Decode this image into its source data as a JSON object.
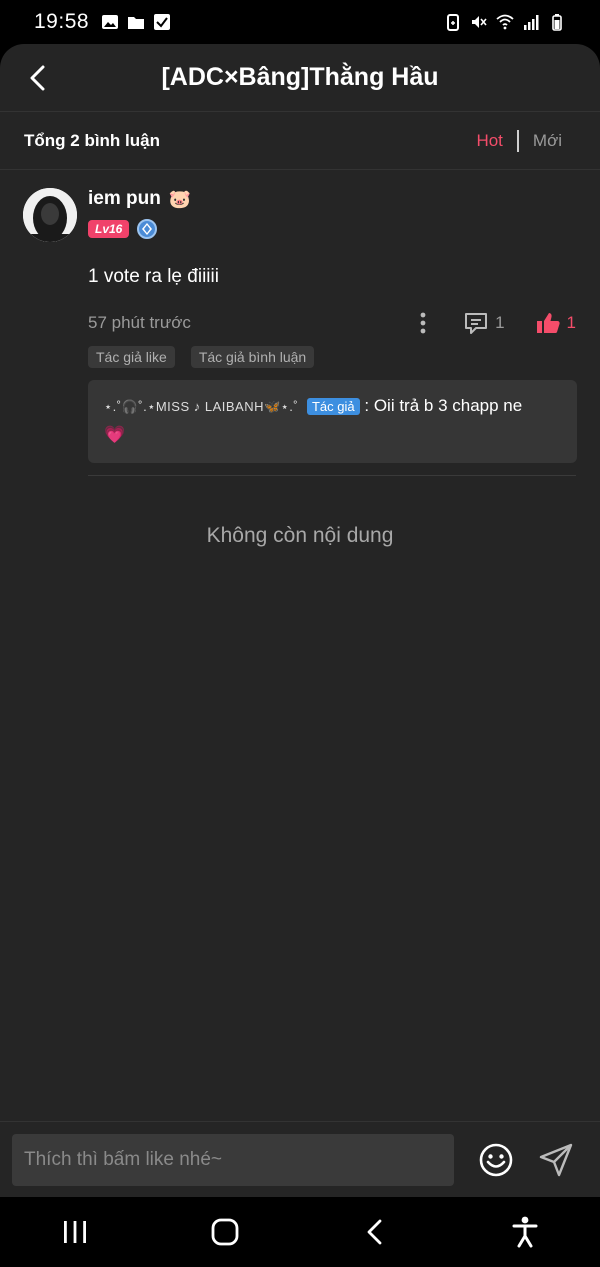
{
  "status_bar": {
    "time": "19:58",
    "left_icons": [
      "image-icon",
      "folder-icon",
      "checkbox-icon"
    ],
    "right_icons": [
      "battery-saver-icon",
      "mute-icon",
      "wifi-icon",
      "signal-icon",
      "battery-icon"
    ]
  },
  "header": {
    "title": "[ADC×Bâng]Thằng Hầu",
    "back_icon": "chevron-left-icon"
  },
  "comments_header": {
    "total_label": "Tổng 2 bình luận",
    "sort_hot": "Hot",
    "sort_new": "Mới",
    "active_sort": "Hot"
  },
  "comment": {
    "username": "iem pun",
    "username_emoji": "🐷",
    "level": "Lv16",
    "text": "1 vote ra lẹ điiiii",
    "timestamp": "57 phút trước",
    "reply_count": "1",
    "like_count": "1",
    "tags": [
      "Tác giả like",
      "Tác giả bình luận"
    ],
    "reply": {
      "author": "⋆.˚🎧˚.⋆MISS ♪ LAIBANH🦋⋆.˚",
      "author_tag": "Tác giả",
      "separator": ":",
      "text": "Oii trả b 3 chapp ne",
      "emoji": "💗"
    }
  },
  "end_message": "Không còn nội dung",
  "input": {
    "placeholder": "Thích thì bấm like nhé~"
  },
  "colors": {
    "accent": "#f44d6a",
    "sheet_bg": "#252525",
    "author_tag_bg": "#3d8fe0"
  }
}
